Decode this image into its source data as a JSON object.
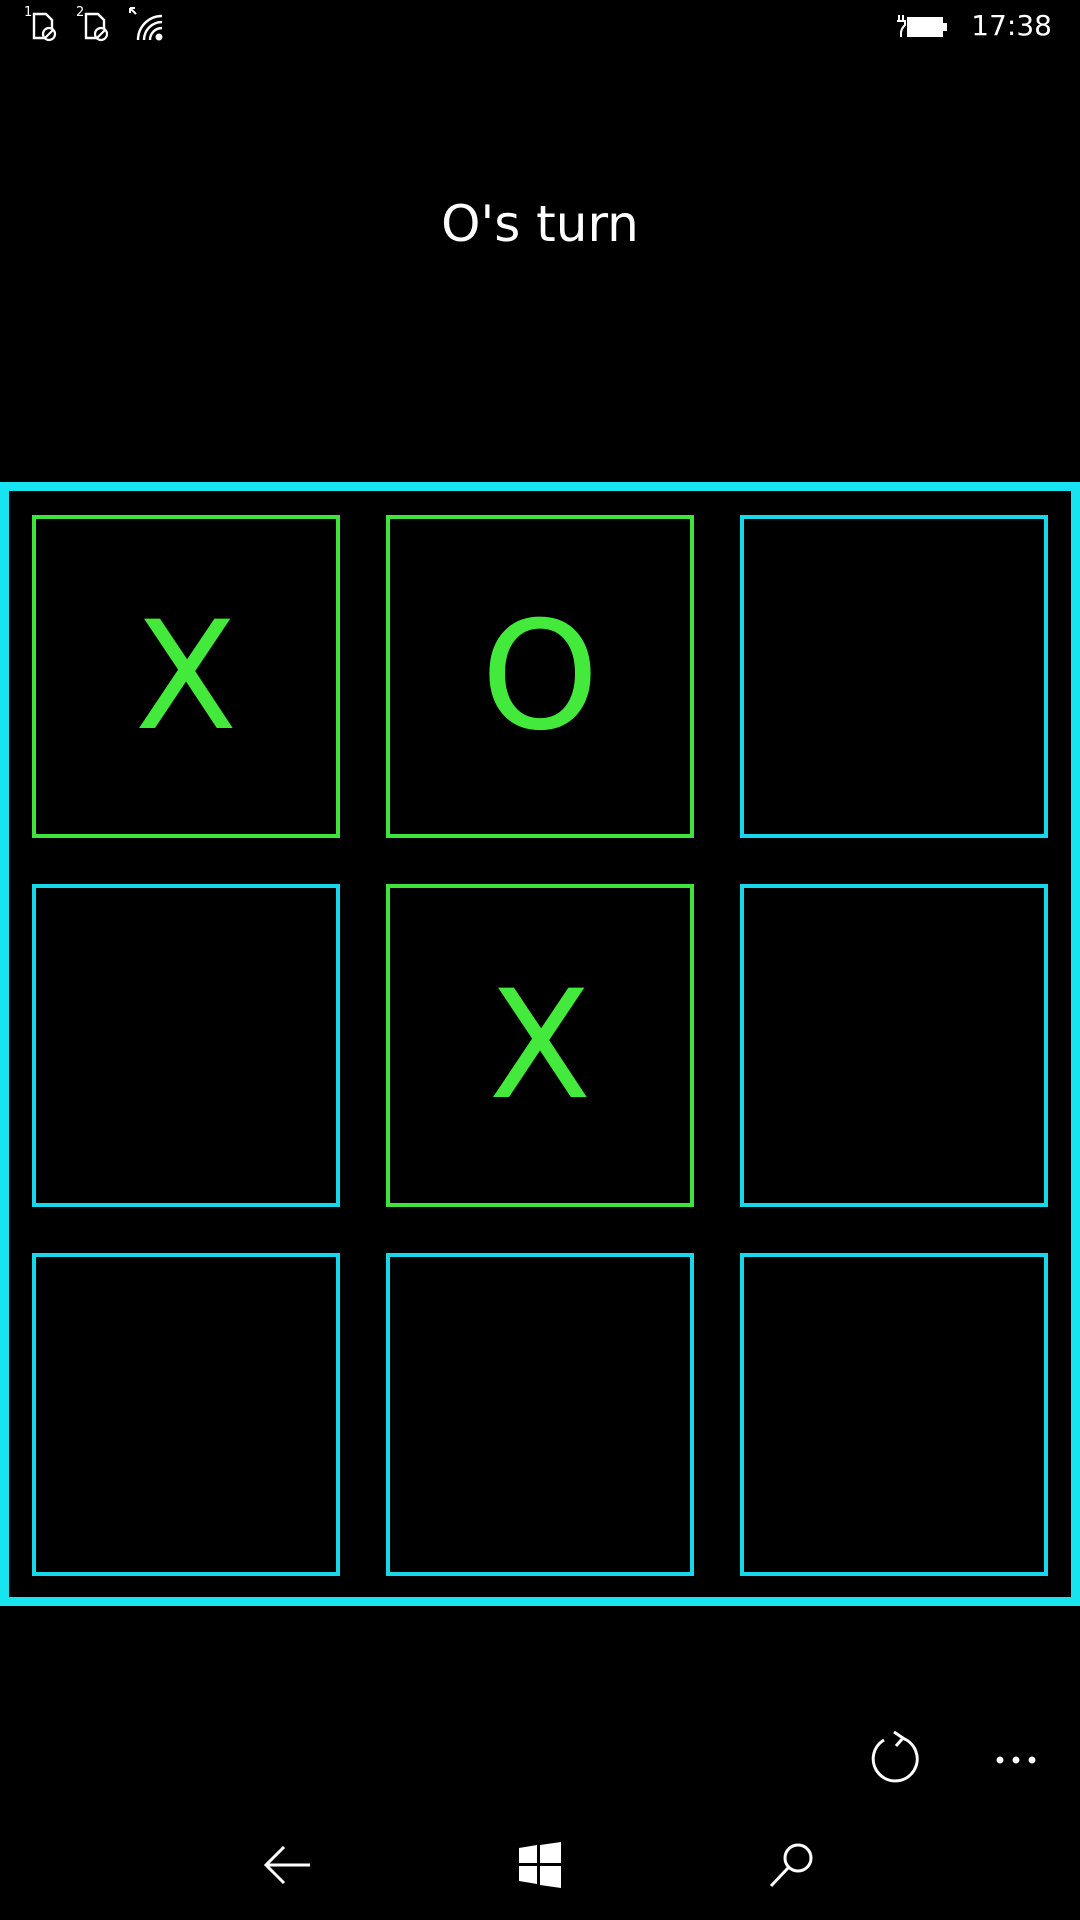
{
  "status_bar": {
    "sim1_label": "1",
    "sim2_label": "2",
    "time": "17:38",
    "icons": [
      "sim1-no-service-icon",
      "sim2-no-service-icon",
      "wifi-icon",
      "battery-charging-icon"
    ]
  },
  "game": {
    "turn_text": "O's turn",
    "cells": [
      "X",
      "O",
      "",
      "",
      "X",
      "",
      "",
      "",
      ""
    ],
    "colors": {
      "board_border": "#16e4f0",
      "empty_cell_border": "#17d8ea",
      "filled_cell_border": "#3ee43b",
      "mark": "#44ea3b"
    }
  },
  "app_bar": {
    "icons": [
      "refresh-icon",
      "more-icon"
    ],
    "more_label": "..."
  },
  "nav_bar": {
    "icons": [
      "back-icon",
      "windows-start-icon",
      "search-icon"
    ]
  }
}
